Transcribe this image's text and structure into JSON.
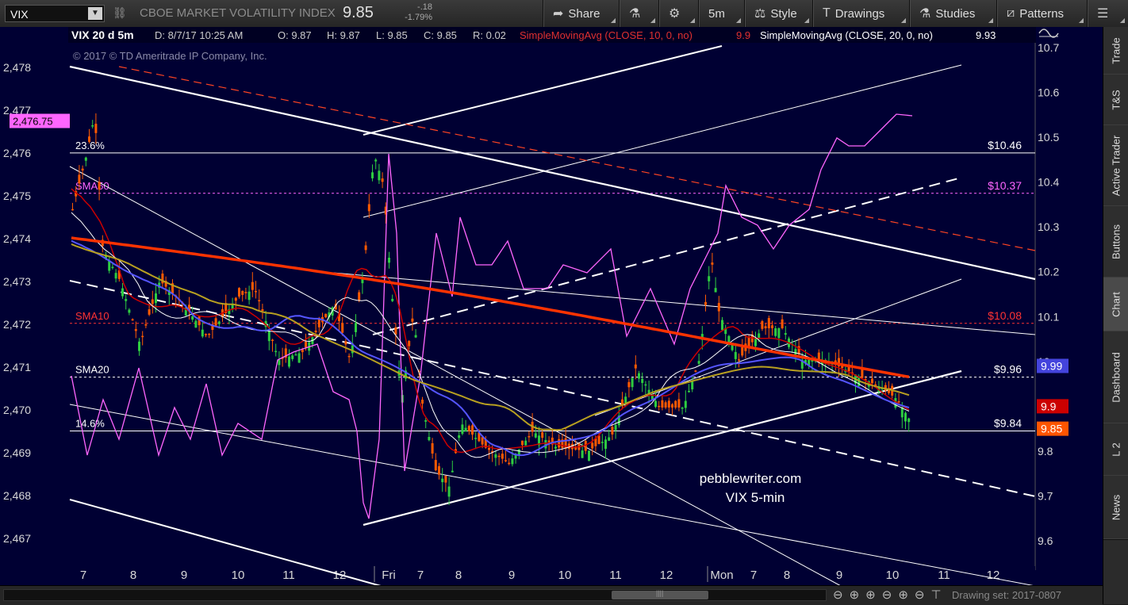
{
  "toolbar": {
    "symbol": "VIX",
    "link_glyph": "⛓",
    "description": "CBOE MARKET VOLATILITY INDEX",
    "last": "9.85",
    "change": "-.18",
    "change_pct": "-1.79%",
    "buttons": [
      {
        "label": "Share",
        "icon": "share-icon",
        "glyph": "➦"
      },
      {
        "label": "",
        "icon": "flask-icon",
        "glyph": "⚗"
      },
      {
        "label": "",
        "icon": "gear-icon",
        "glyph": "⚙"
      },
      {
        "label": "5m",
        "icon": "",
        "glyph": ""
      },
      {
        "label": "Style",
        "icon": "style-icon",
        "glyph": "⚖"
      },
      {
        "label": "Drawings",
        "icon": "text-icon",
        "glyph": "T"
      },
      {
        "label": "Studies",
        "icon": "flask-icon",
        "glyph": "⚗"
      },
      {
        "label": "Patterns",
        "icon": "patterns-icon",
        "glyph": "⧄"
      },
      {
        "label": "",
        "icon": "menu-icon",
        "glyph": "☰"
      }
    ]
  },
  "header": {
    "title": "VIX 20 d 5m",
    "date": "D: 8/7/17 10:25 AM",
    "open": "O: 9.87",
    "high": "H: 9.87",
    "low": "L: 9.85",
    "close": "C: 9.85",
    "range": "R: 0.02",
    "sma10": "SimpleMovingAvg (CLOSE, 10, 0, no)",
    "sma10_val": "9.9",
    "sma20": "SimpleMovingAvg (CLOSE, 20, 0, no)",
    "sma20_val": "9.93"
  },
  "copyright": "© 2017 © TD Ameritrade IP Company, Inc.",
  "annotation": {
    "line1": "pebblewriter.com",
    "line2": "VIX 5-min"
  },
  "chart_data": {
    "type": "line",
    "title": "VIX 20 d 5m",
    "left_axis": {
      "min": 2466.6,
      "max": 2478.3,
      "ticks": [
        "2,467",
        "2,468",
        "2,469",
        "2,470",
        "2,471",
        "2,472",
        "2,473",
        "2,474",
        "2,475",
        "2,476",
        "2,477",
        "2,478"
      ],
      "marker": "2,476.75",
      "marker_color": "#ff66ff"
    },
    "right_axis": {
      "min": 9.55,
      "max": 10.72,
      "ticks": [
        "9.6",
        "9.7",
        "9.8",
        "9.9",
        "10",
        "10.1",
        "10.2",
        "10.3",
        "10.4",
        "10.5",
        "10.6",
        "10.7"
      ]
    },
    "x_labels": [
      "7",
      "8",
      "9",
      "10",
      "11",
      "12",
      "Fri",
      "7",
      "8",
      "9",
      "10",
      "11",
      "12",
      "Mon",
      "7",
      "8",
      "9",
      "10",
      "11",
      "12"
    ],
    "horizontal_levels": [
      {
        "label": "23.6%",
        "price_label": "$10.46",
        "value": 10.465,
        "color": "#ffffff",
        "style": "solid"
      },
      {
        "label": "SMA50",
        "price_label": "$10.37",
        "value": 10.375,
        "color": "#ff66ff",
        "style": "dotted"
      },
      {
        "label": "SMA10",
        "price_label": "$10.08",
        "value": 10.085,
        "color": "#ff3333",
        "style": "dotted"
      },
      {
        "label": "SMA20",
        "price_label": "$9.96",
        "value": 9.965,
        "color": "#ffffff",
        "style": "dotted"
      },
      {
        "label": "14.6%",
        "price_label": "$9.84",
        "value": 9.845,
        "color": "#ffffff",
        "style": "solid"
      }
    ],
    "price_badges": [
      {
        "value": "9.99",
        "color": "#4444dd"
      },
      {
        "value": "9.9",
        "color": "#cc0000"
      },
      {
        "value": "9.85",
        "color": "#ff5500"
      }
    ],
    "series": [
      {
        "name": "SimpleMovingAvg (CLOSE, 10, 0, no)",
        "color": "#cc0000"
      },
      {
        "name": "SimpleMovingAvg (CLOSE, 20, 0, no)",
        "color": "#ffffff"
      },
      {
        "name": "",
        "color": "#5555ff"
      },
      {
        "name": "",
        "color": "#ff3300"
      },
      {
        "name": "",
        "color": "#b8a020"
      },
      {
        "name": "",
        "color": "#ff66ff"
      }
    ],
    "grid": false
  },
  "side_tabs": [
    "Trade",
    "T&S",
    "Active Trader",
    "Buttons",
    "Chart",
    "Dashboard",
    "L 2",
    "News"
  ],
  "bottom": {
    "scroll_grip": "||||",
    "drawing_set": "Drawing set: 2017-0807",
    "icons": [
      "⊖",
      "⊕",
      "⊕",
      "⊖",
      "⊕",
      "⊖",
      "⊤"
    ]
  }
}
